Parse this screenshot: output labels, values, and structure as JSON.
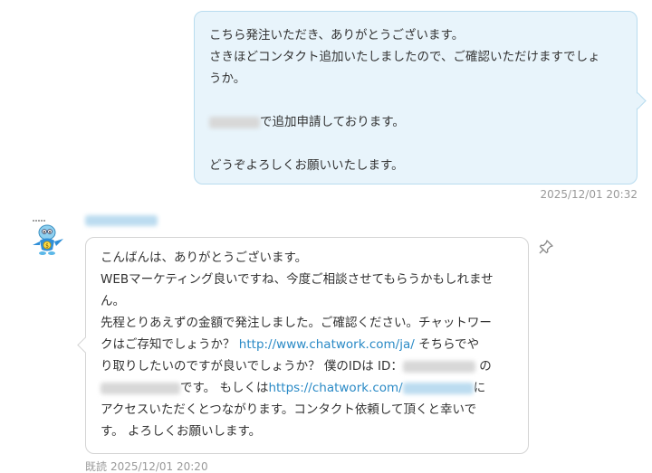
{
  "outgoing": {
    "line1": "こちら発注いただき、ありがとうございます。",
    "line2": "さきほどコンタクト追加いたしましたので、ご確認いただけますでしょ",
    "line3": "うか。",
    "line4_suffix": "で追加申請しております。",
    "line5": "どうぞよろしくお願いいたします。",
    "timestamp": "2025/12/01 20:32"
  },
  "incoming": {
    "line1": "こんばんは、ありがとうございます。",
    "line2": "WEBマーケティング良いですね、今度ご相談させてもらうかもしれませ",
    "line3": "ん。",
    "line4": "先程とりあえずの金額で発注しました。ご確認ください。チャットワー",
    "line5_pre": "クはご存知でしょうか？ ",
    "line5_link": "http://www.chatwork.com/ja/",
    "line5_post": " そちらでや",
    "line6_pre": "り取りしたいのですが良いでしょうか？ 僕のIDは ID：",
    "line6_post": " の",
    "line7_mid": "です。 もしくは",
    "line7_link": "https://chatwork.com/",
    "line7_post": "に",
    "line8": "アクセスいただくとつながります。コンタクト依頼して頂くと幸いで",
    "line9": "す。 よろしくお願いします。",
    "read_label": "既読",
    "timestamp": "2025/12/01 20:20"
  },
  "icons": {
    "avatar": "mascot-avatar-icon",
    "pin": "pin-icon"
  },
  "colors": {
    "outgoing_bg": "#e8f4fb",
    "link": "#2a8ac6",
    "timestamp": "#999999"
  }
}
